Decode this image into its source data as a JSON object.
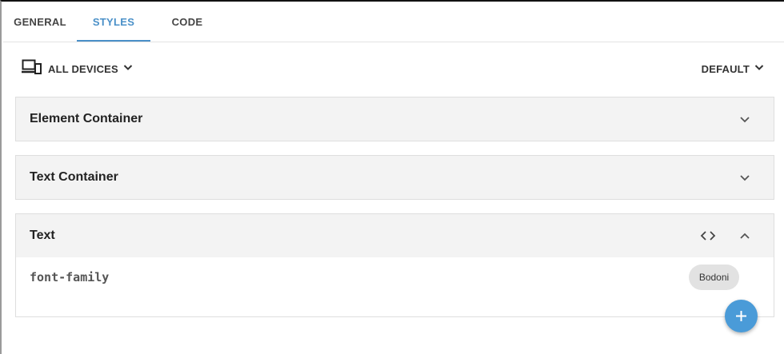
{
  "tabs": [
    {
      "label": "GENERAL",
      "active": false
    },
    {
      "label": "STYLES",
      "active": true
    },
    {
      "label": "CODE",
      "active": false
    }
  ],
  "toolbar": {
    "devices_label": "ALL DEVICES",
    "devices_icon": "devices-icon",
    "default_label": "DEFAULT"
  },
  "panels": [
    {
      "title": "Element Container",
      "expanded": false
    },
    {
      "title": "Text Container",
      "expanded": false
    },
    {
      "title": "Text",
      "expanded": true,
      "properties": [
        {
          "name": "font-family",
          "value": "Bodoni"
        }
      ]
    }
  ],
  "fab": {
    "icon": "plus-icon"
  },
  "colors": {
    "accent": "#4a90c8",
    "fab": "#4a9bd8",
    "panel_bg": "#f3f3f3",
    "chip_bg": "#e2e2e2"
  }
}
